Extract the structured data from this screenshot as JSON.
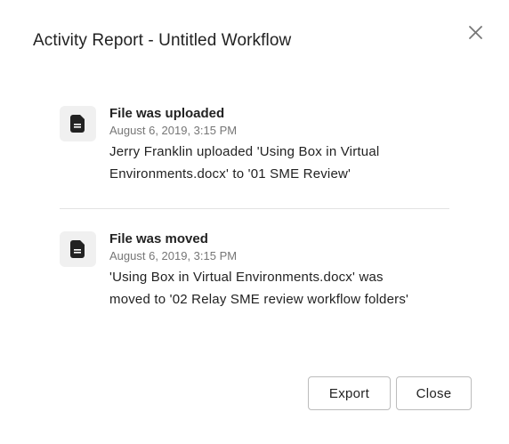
{
  "dialog": {
    "title": "Activity Report - Untitled Workflow"
  },
  "activities": [
    {
      "icon": "file-icon",
      "heading": "File was uploaded",
      "time": "August 6, 2019, 3:15 PM",
      "description_line1": "Jerry Franklin uploaded 'Using Box in Virtual",
      "description_line2": "Environments.docx' to '01 SME Review'"
    },
    {
      "icon": "file-icon",
      "heading": "File was moved",
      "time": "August 6, 2019, 3:15 PM",
      "description_line1": "'Using Box in Virtual Environments.docx' was",
      "description_line2": "moved to '02 Relay SME review workflow folders'"
    }
  ],
  "footer": {
    "export_label": "Export",
    "close_label": "Close"
  },
  "colors": {
    "text": "#222222",
    "muted": "#767676",
    "tile": "#f0f0f0",
    "icon": "#222222",
    "border": "#bcbcbc"
  }
}
